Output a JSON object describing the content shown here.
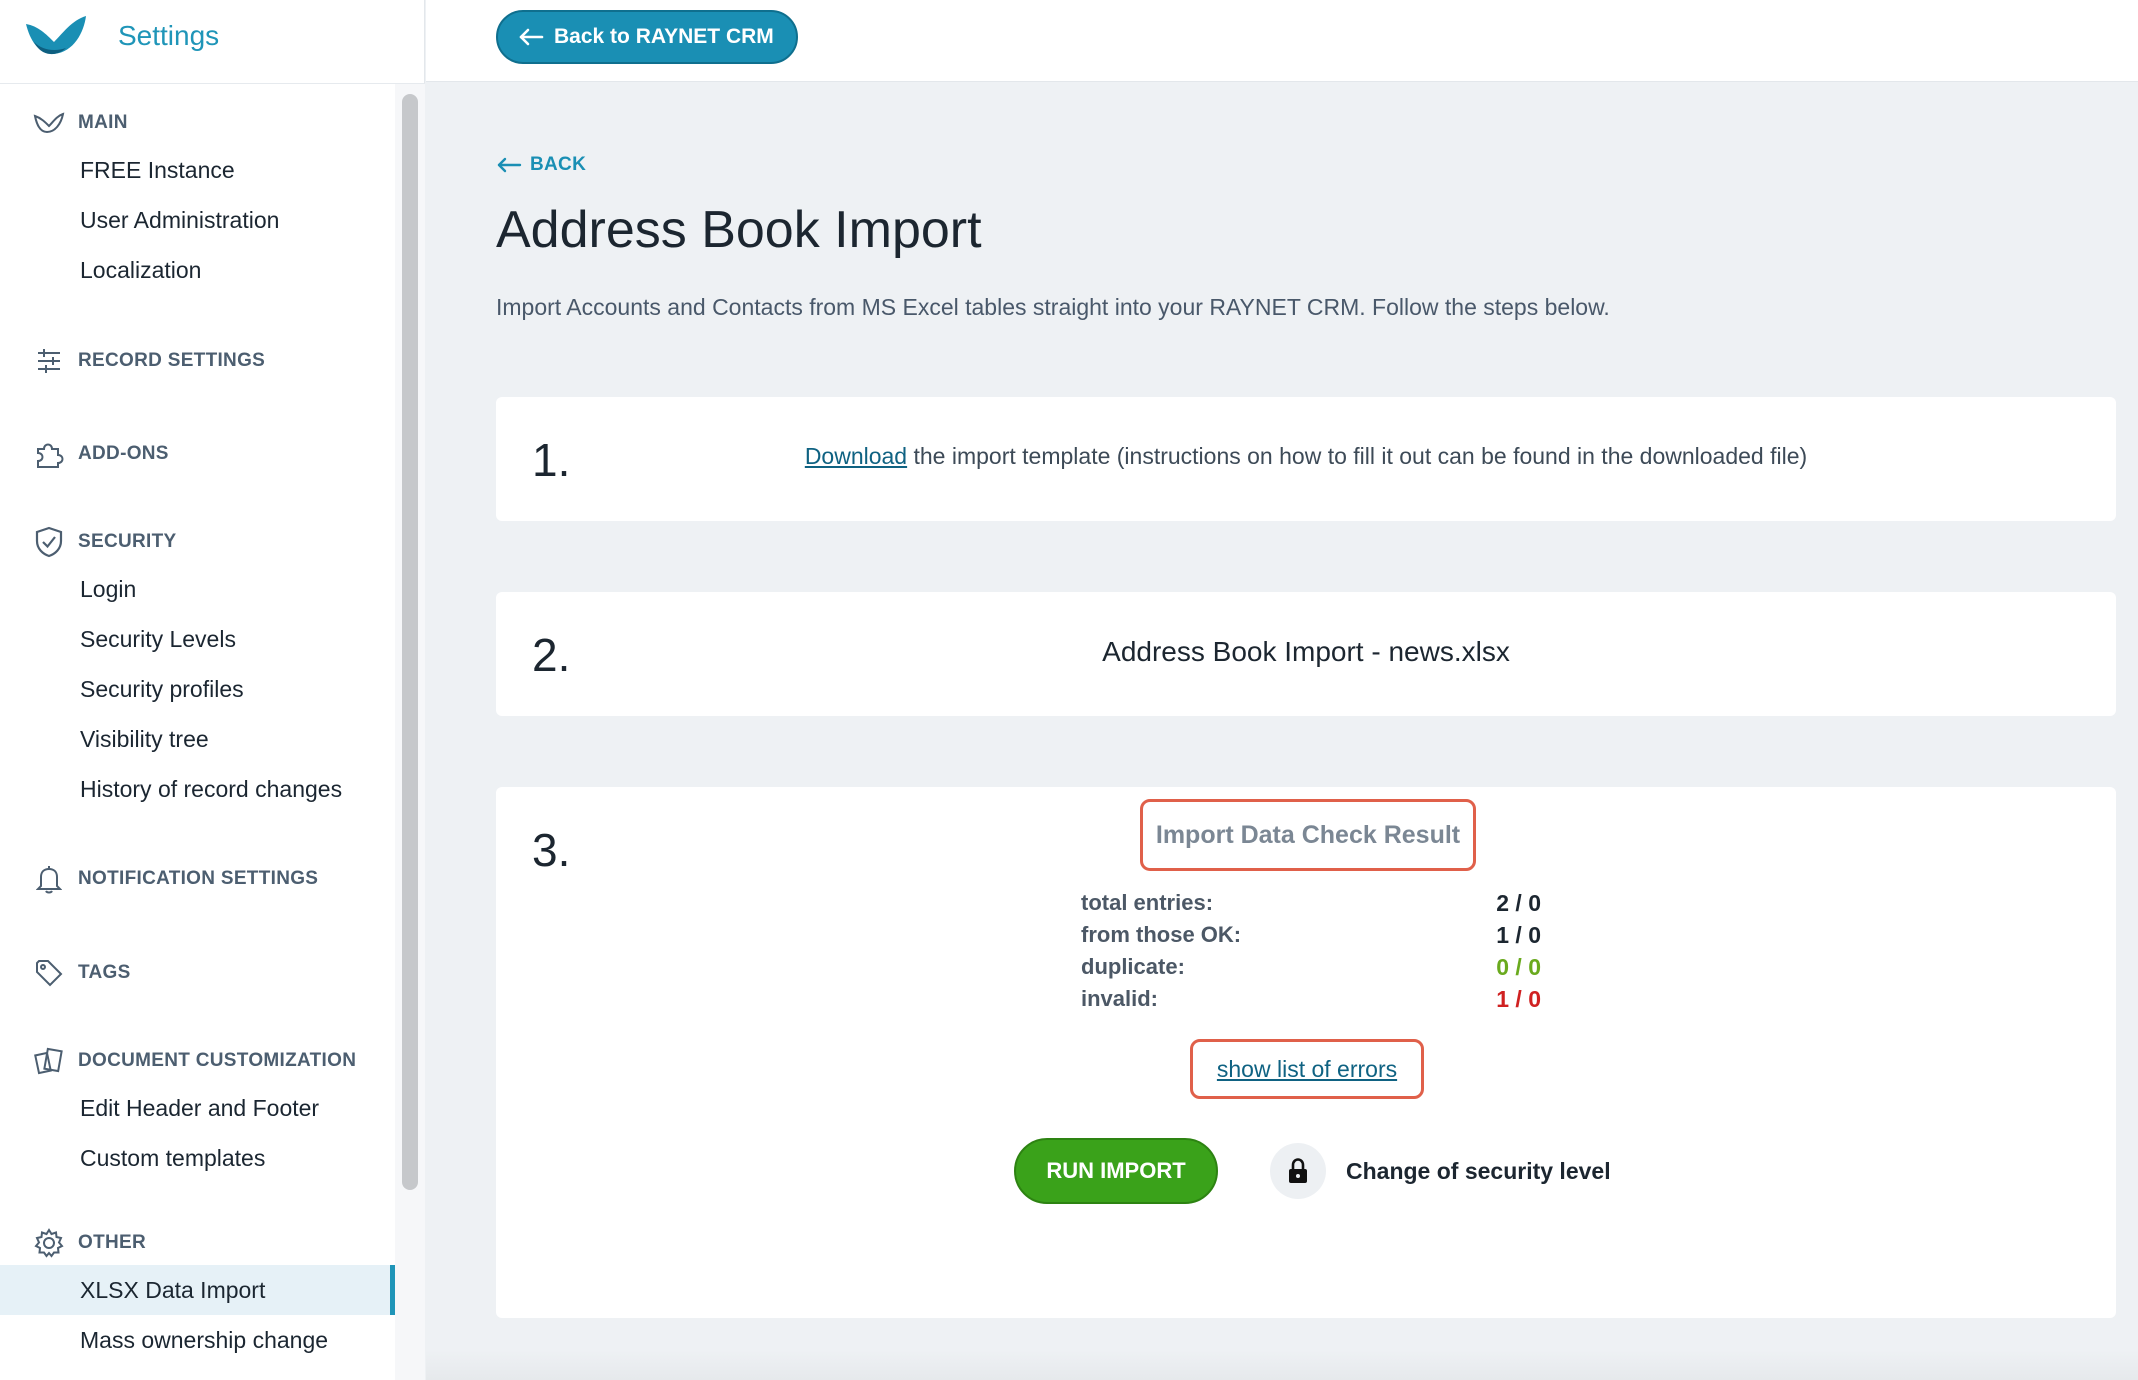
{
  "app": {
    "title": "Settings"
  },
  "topbar": {
    "back_crm_label": "Back to RAYNET CRM"
  },
  "sidebar": {
    "sections": [
      {
        "label": "MAIN",
        "icon": "main-icon",
        "items": [
          "FREE Instance",
          "User Administration",
          "Localization"
        ]
      },
      {
        "label": "RECORD SETTINGS",
        "icon": "sliders-icon",
        "items": []
      },
      {
        "label": "ADD-ONS",
        "icon": "puzzle-icon",
        "items": []
      },
      {
        "label": "SECURITY",
        "icon": "shield-icon",
        "items": [
          "Login",
          "Security Levels",
          "Security profiles",
          "Visibility tree",
          "History of record changes"
        ]
      },
      {
        "label": "NOTIFICATION SETTINGS",
        "icon": "bell-icon",
        "items": []
      },
      {
        "label": "TAGS",
        "icon": "tag-icon",
        "items": []
      },
      {
        "label": "DOCUMENT CUSTOMIZATION",
        "icon": "documents-icon",
        "items": [
          "Edit Header and Footer",
          "Custom templates"
        ]
      },
      {
        "label": "OTHER",
        "icon": "gear-icon",
        "items": [
          "XLSX Data Import",
          "Mass ownership change"
        ]
      }
    ],
    "active_item": "XLSX Data Import"
  },
  "main": {
    "back_label": "BACK",
    "title": "Address Book Import",
    "description": "Import Accounts and Contacts from MS Excel tables straight into your RAYNET CRM. Follow the steps below.",
    "step1": {
      "number": "1.",
      "link_text": "Download",
      "text": " the import template (instructions on how to fill it out can be found in the downloaded file)"
    },
    "step2": {
      "number": "2.",
      "text": "Address Book Import - news.xlsx"
    },
    "step3": {
      "number": "3.",
      "result_title": "Import Data Check Result",
      "stats": [
        {
          "label": "total entries:",
          "value": "2 / 0",
          "color": "#1c2630"
        },
        {
          "label": "from those OK:",
          "value": "1 / 0",
          "color": "#1c2630"
        },
        {
          "label": "duplicate:",
          "value": "0 / 0",
          "color": "#6aaa1e"
        },
        {
          "label": "invalid:",
          "value": "1 / 0",
          "color": "#d02121"
        }
      ],
      "errors_link": "show list of errors",
      "run_import_label": "RUN IMPORT",
      "security_label": "Change of security level"
    }
  }
}
